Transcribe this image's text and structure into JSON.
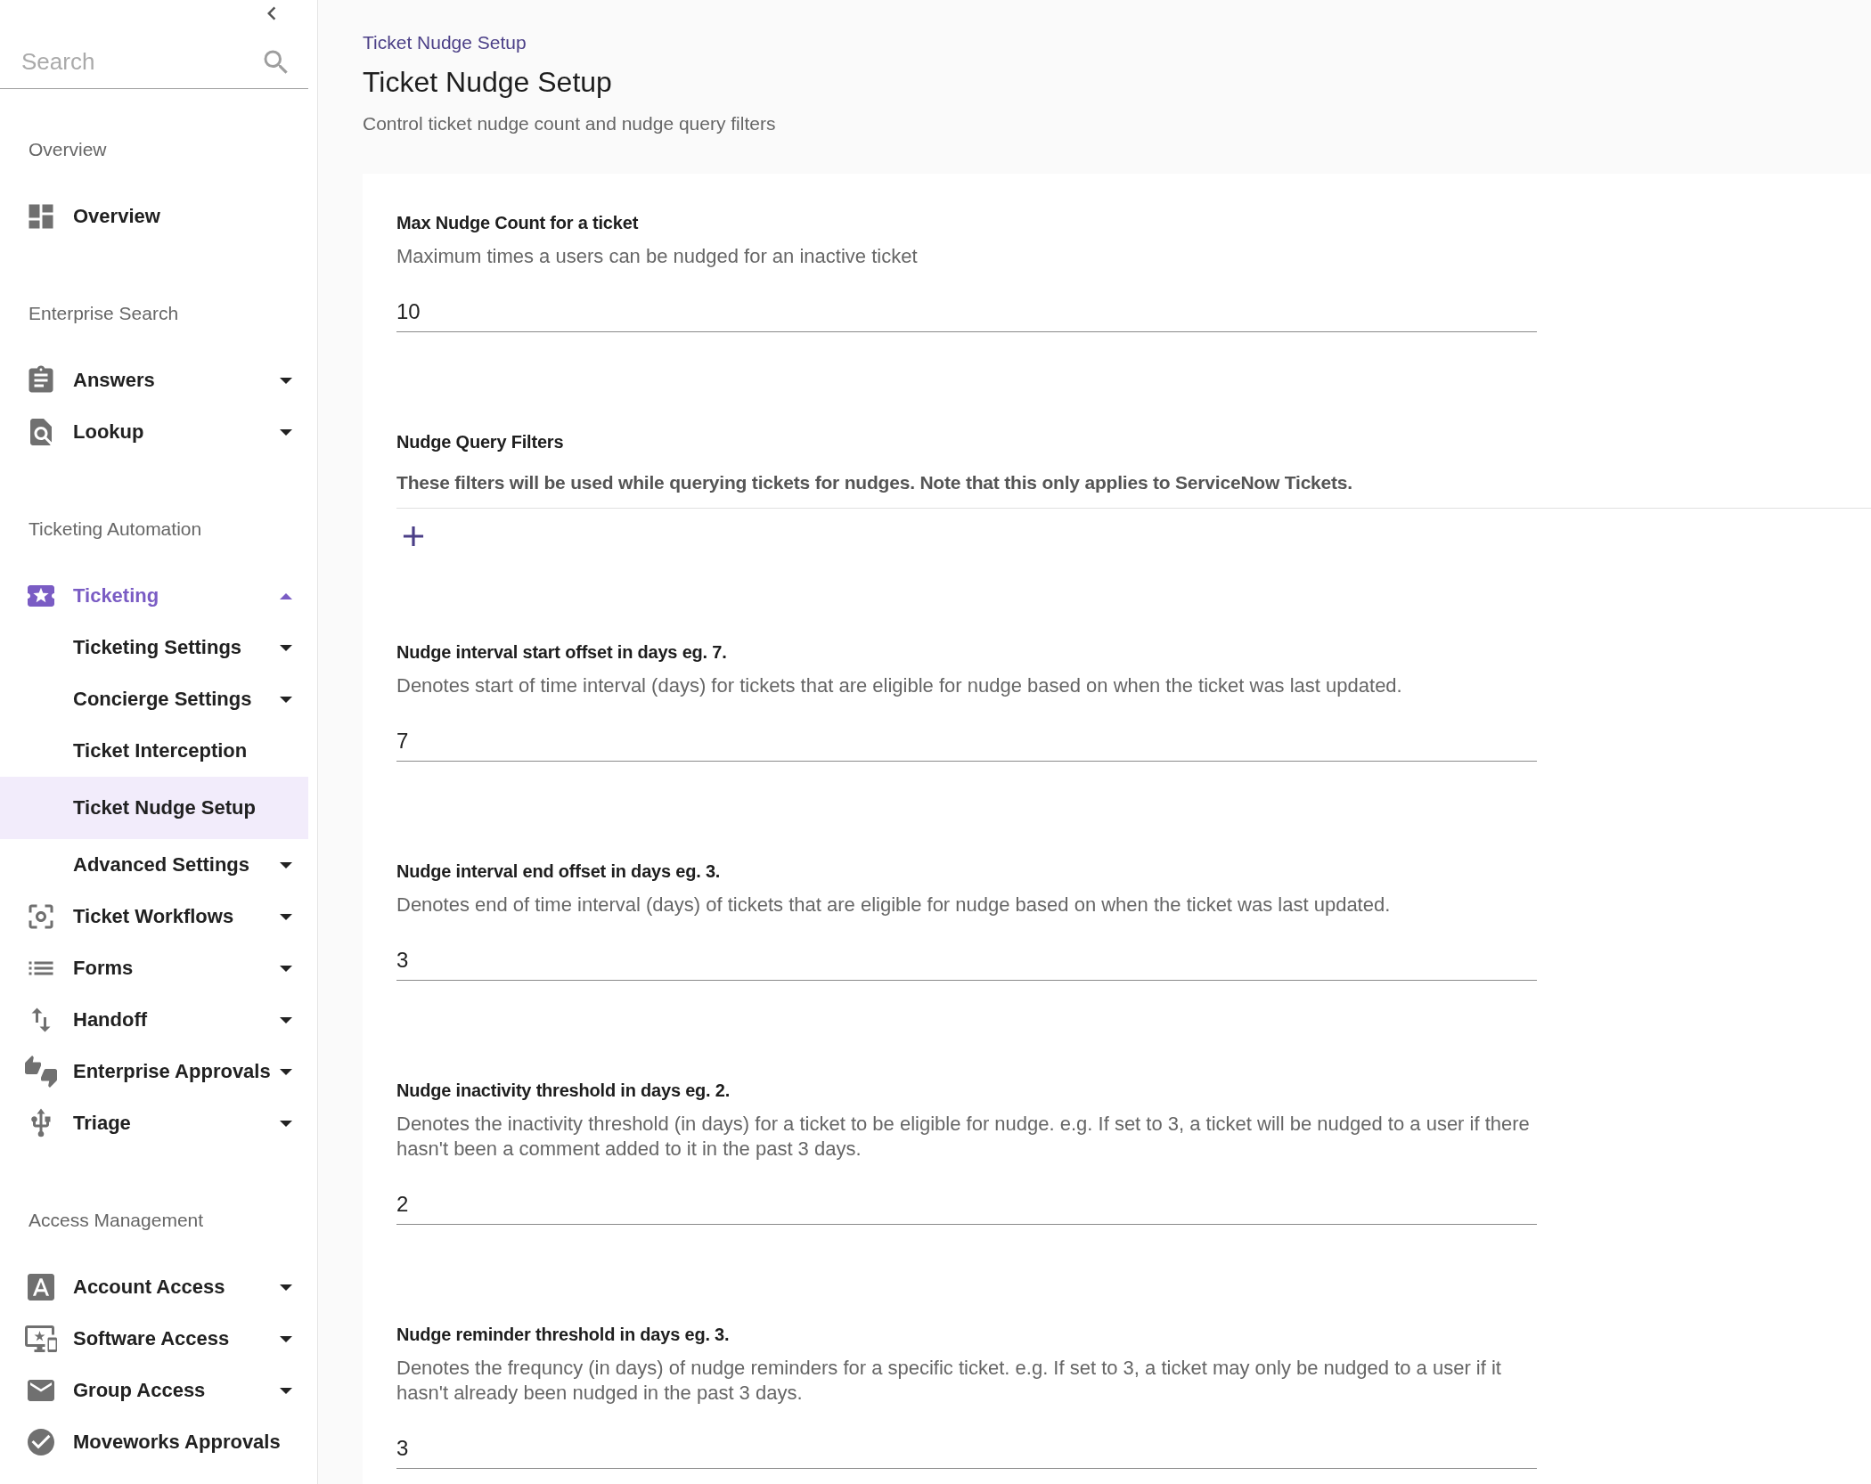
{
  "sidebar": {
    "search": {
      "placeholder": "Search"
    },
    "sections": [
      {
        "title": "Overview",
        "items": [
          {
            "label": "Overview",
            "selected": false
          }
        ]
      },
      {
        "title": "Enterprise Search",
        "items": [
          {
            "label": "Answers",
            "expanded": false,
            "selected": false
          },
          {
            "label": "Lookup",
            "expanded": false,
            "selected": false
          }
        ]
      },
      {
        "title": "Ticketing Automation",
        "items": [
          {
            "label": "Ticketing",
            "expanded": true,
            "selected": false,
            "children": [
              {
                "label": "Ticketing Settings",
                "expanded": false,
                "selected": false
              },
              {
                "label": "Concierge Settings",
                "expanded": false,
                "selected": false
              },
              {
                "label": "Ticket Interception",
                "selected": false
              },
              {
                "label": "Ticket Nudge Setup",
                "selected": true
              },
              {
                "label": "Advanced Settings",
                "expanded": false,
                "selected": false
              }
            ]
          },
          {
            "label": "Ticket Workflows",
            "expanded": false,
            "selected": false
          },
          {
            "label": "Forms",
            "expanded": false,
            "selected": false
          },
          {
            "label": "Handoff",
            "expanded": false,
            "selected": false
          },
          {
            "label": "Enterprise Approvals",
            "expanded": false,
            "selected": false
          },
          {
            "label": "Triage",
            "expanded": false,
            "selected": false
          }
        ]
      },
      {
        "title": "Access Management",
        "items": [
          {
            "label": "Account Access",
            "expanded": false,
            "selected": false
          },
          {
            "label": "Software Access",
            "expanded": false,
            "selected": false
          },
          {
            "label": "Group Access",
            "expanded": false,
            "selected": false
          },
          {
            "label": "Moveworks Approvals",
            "selected": false
          }
        ]
      }
    ]
  },
  "page": {
    "breadcrumb": "Ticket Nudge Setup",
    "title": "Ticket Nudge Setup",
    "subtitle": "Control ticket nudge count and nudge query filters",
    "settings": [
      {
        "kind": "number",
        "label": "Max Nudge Count for a ticket",
        "description": "Maximum times a users can be nudged for an inactive ticket",
        "value": "10"
      },
      {
        "kind": "filters",
        "label": "Nudge Query Filters",
        "description": "These filters will be used while querying tickets for nudges. Note that this only applies to ServiceNow Tickets."
      },
      {
        "kind": "number",
        "label": "Nudge interval start offset in days eg. 7.",
        "description": "Denotes start of time interval (days) for tickets that are eligible for nudge based on when the ticket was last updated.",
        "value": "7"
      },
      {
        "kind": "number",
        "label": "Nudge interval end offset in days eg. 3.",
        "description": "Denotes end of time interval (days) of tickets that are eligible for nudge based on when the ticket was last updated.",
        "value": "3"
      },
      {
        "kind": "number",
        "label": "Nudge inactivity threshold in days eg. 2.",
        "description": "Denotes the inactivity threshold (in days) for a ticket to be eligible for nudge. e.g. If set to 3, a ticket will be nudged to a user if there hasn't been a comment added to it in the past 3 days.",
        "value": "2"
      },
      {
        "kind": "number",
        "label": "Nudge reminder threshold in days eg. 3.",
        "description": "Denotes the frequncy (in days) of nudge reminders for a specific ticket. e.g. If set to 3, a ticket may only be nudged to a user if it hasn't already been nudged in the past 3 days.",
        "value": "3"
      }
    ]
  }
}
